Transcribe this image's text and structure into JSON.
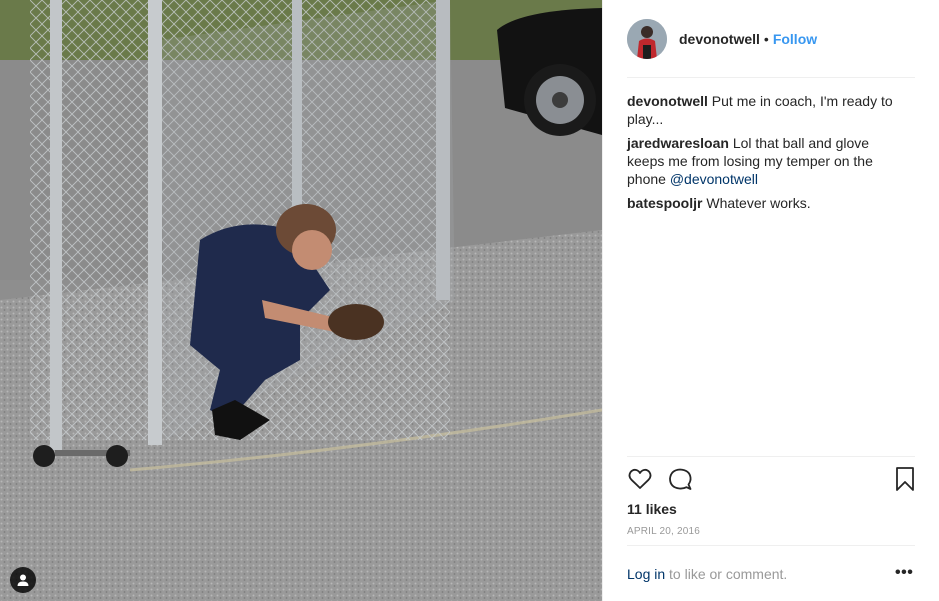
{
  "post": {
    "username": "devonotwell",
    "separator": "•",
    "follow_label": "Follow",
    "comments": [
      {
        "user": "devonotwell",
        "text": "Put me in coach, I'm ready to play..."
      },
      {
        "user": "jaredwaresloan",
        "text": "Lol that ball and glove keeps me from losing my temper on the phone",
        "mention": "@devonotwell"
      },
      {
        "user": "batespooljr",
        "text": "Whatever works."
      }
    ],
    "likes": "11 likes",
    "date": "APRIL 20, 2016",
    "login_link": "Log in",
    "login_suffix": "to like or comment.",
    "more": "•••"
  },
  "icons": {
    "like": "heart-outline-icon",
    "comment": "speech-bubble-icon",
    "save": "bookmark-icon",
    "tag": "user-tag-icon"
  },
  "colors": {
    "link": "#3897f0",
    "mention": "#003569",
    "text": "#262626",
    "muted": "#999999"
  }
}
